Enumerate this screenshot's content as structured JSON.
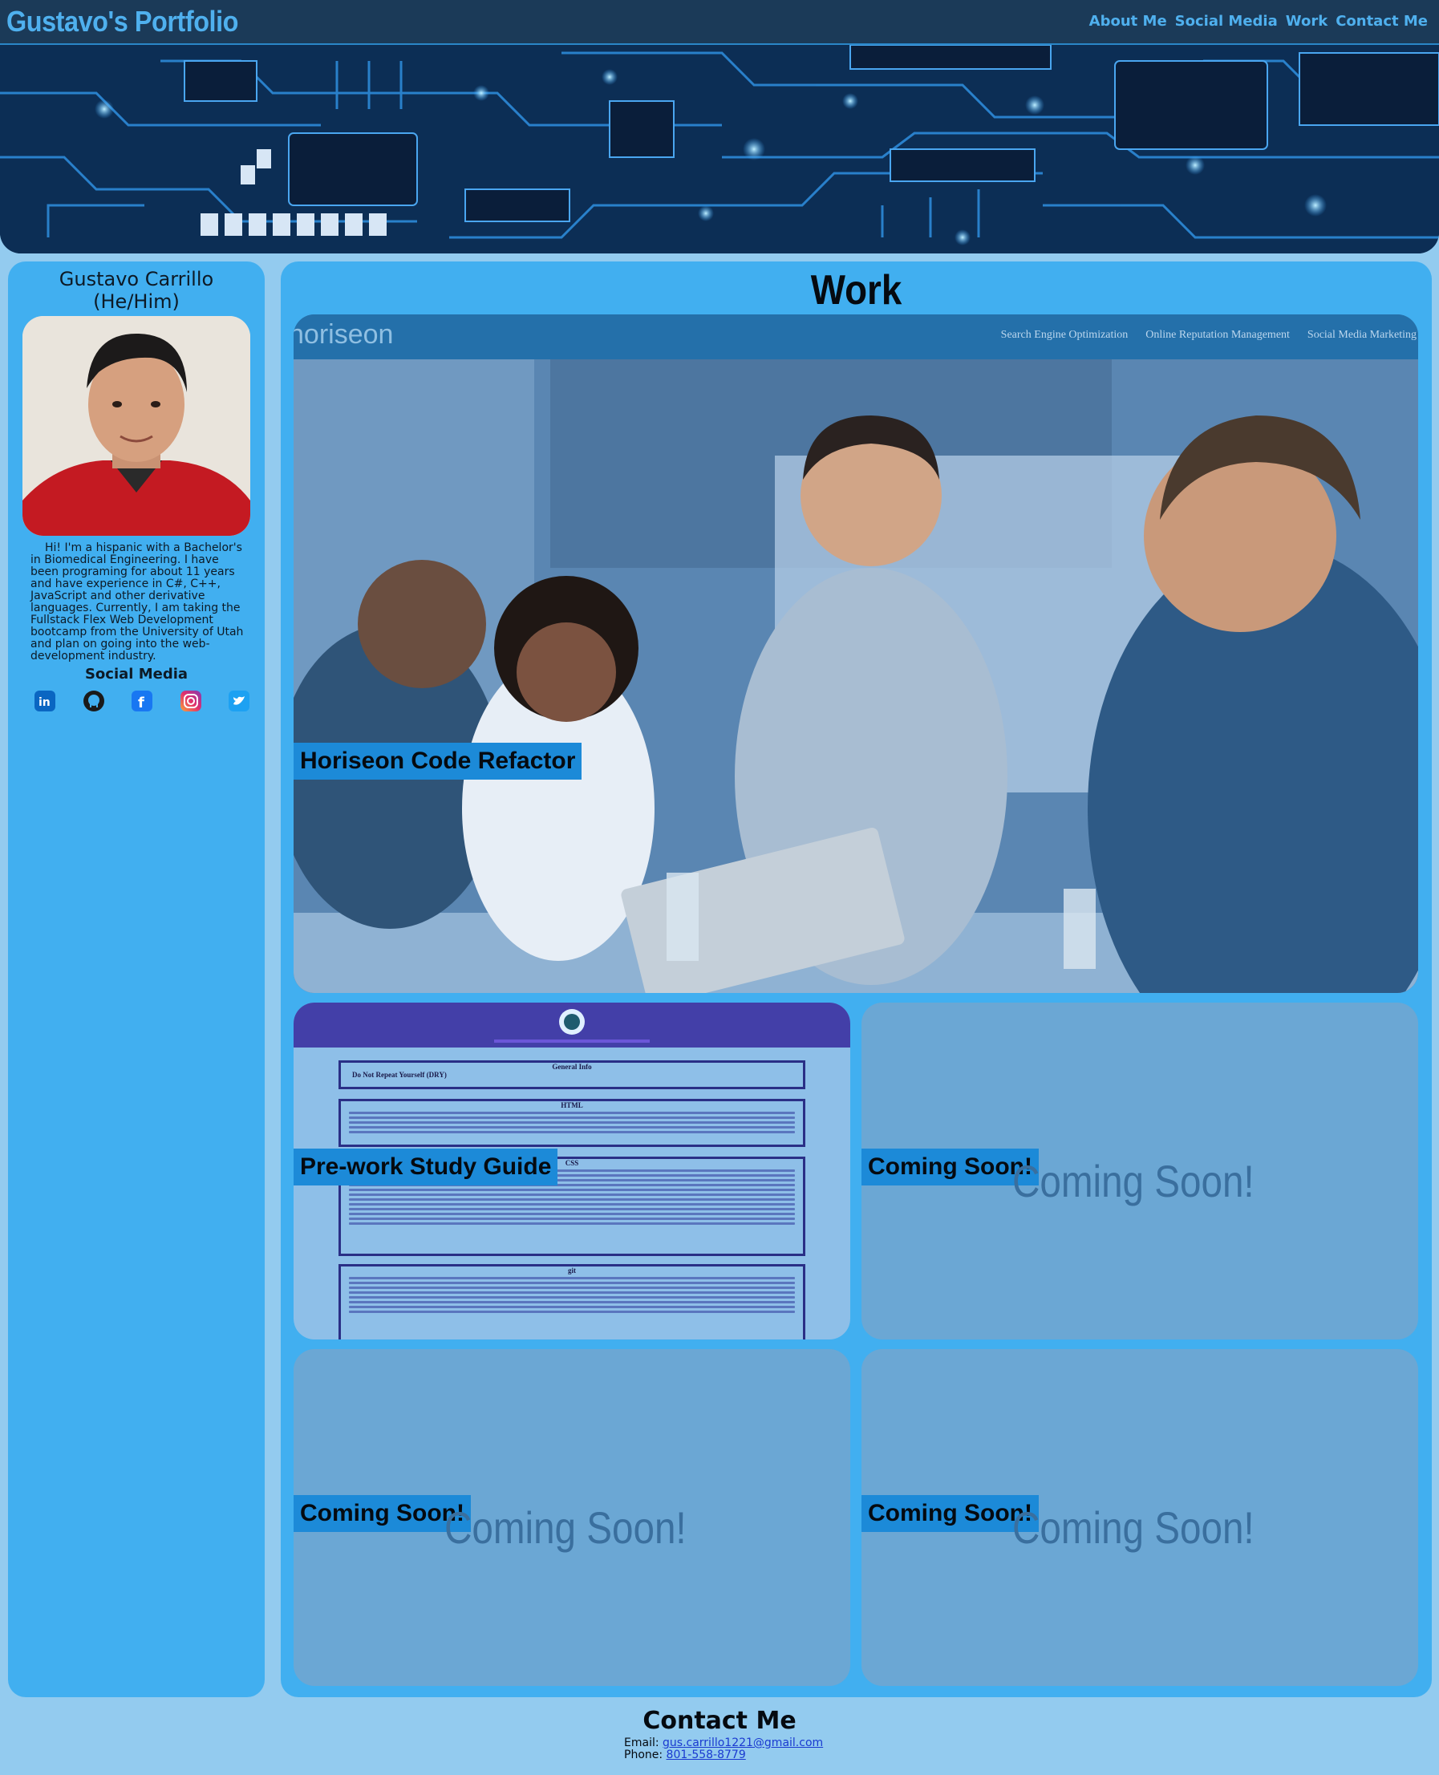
{
  "header": {
    "title": "Gustavo's Portfolio",
    "nav": [
      "About Me",
      "Social Media",
      "Work",
      "Contact Me"
    ]
  },
  "colors": {
    "header_bg": "#1b3a58",
    "accent": "#4fb0ee",
    "panel": "#41aff0",
    "page_bg": "#93cbef",
    "label_bg": "#1c8ad8"
  },
  "profile": {
    "name_line1": "Gustavo Carrillo",
    "name_line2": "(He/Him)",
    "bio": "Hi! I'm a hispanic with a Bachelor's in Biomedical Engineering. I have been programing for about 11 years and have experience in C#, C++, JavaScript and other derivative languages. Currently, I am taking the Fullstack Flex Web Development bootcamp from the University of Utah and plan on going into the web-development industry.",
    "social_title": "Social Media",
    "social_icons": [
      "linkedin-icon",
      "github-icon",
      "facebook-icon",
      "instagram-icon",
      "twitter-icon"
    ]
  },
  "work": {
    "title": "Work",
    "projects": [
      {
        "label": "Horiseon Code Refactor",
        "preview": {
          "logo": "horiseon",
          "links": [
            "Search Engine Optimization",
            "Online Reputation Management",
            "Social Media Marketing"
          ]
        }
      },
      {
        "label": "Pre-work Study Guide",
        "preview": {
          "sections": [
            "General Info",
            "HTML",
            "CSS",
            "git"
          ],
          "first_heading": "Do Not Repeat Yourself (DRY)"
        }
      },
      {
        "label": "Coming Soon!",
        "placeholder": "Coming Soon!"
      },
      {
        "label": "Coming Soon!",
        "placeholder": "Coming Soon!"
      },
      {
        "label": "Coming Soon!",
        "placeholder": "Coming Soon!"
      }
    ]
  },
  "contact": {
    "title": "Contact Me",
    "email_label": "Email:",
    "email": "gus.carrillo1221@gmail.com",
    "phone_label": "Phone:",
    "phone": "801-558-8779"
  }
}
